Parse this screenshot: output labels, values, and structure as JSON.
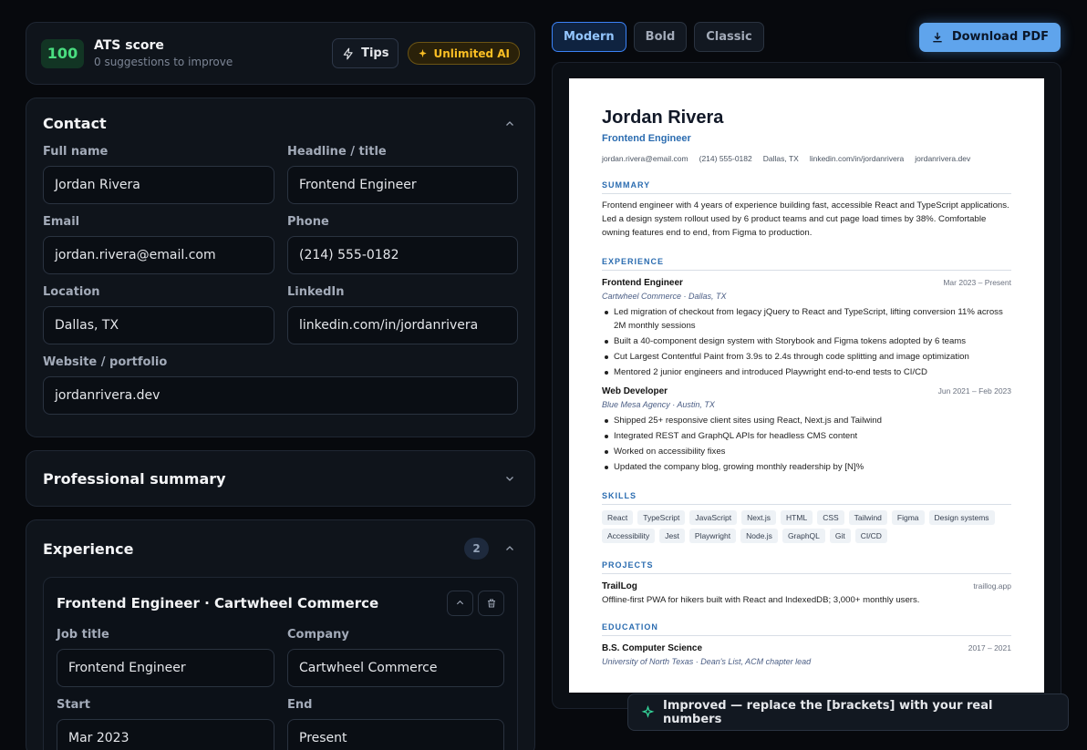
{
  "ats": {
    "score": "100",
    "title": "ATS score",
    "subtitle": "0 suggestions to improve",
    "tips_label": "Tips",
    "ai_badge": "Unlimited AI"
  },
  "contact": {
    "title": "Contact",
    "fields": [
      {
        "label": "Full name",
        "value": "Jordan Rivera"
      },
      {
        "label": "Headline / title",
        "value": "Frontend Engineer"
      },
      {
        "label": "Email",
        "value": "jordan.rivera@email.com"
      },
      {
        "label": "Phone",
        "value": "(214) 555-0182"
      },
      {
        "label": "Location",
        "value": "Dallas, TX"
      },
      {
        "label": "LinkedIn",
        "value": "linkedin.com/in/jordanrivera"
      },
      {
        "label": "Website / portfolio",
        "value": "jordanrivera.dev"
      }
    ]
  },
  "summary_section": {
    "title": "Professional summary"
  },
  "experience_section": {
    "title": "Experience",
    "count": "2",
    "job": {
      "title": "Frontend Engineer · Cartwheel Commerce",
      "fields": [
        {
          "label": "Job title",
          "value": "Frontend Engineer"
        },
        {
          "label": "Company",
          "value": "Cartwheel Commerce"
        },
        {
          "label": "Start",
          "value": "Mar 2023"
        },
        {
          "label": "End",
          "value": "Present"
        }
      ]
    }
  },
  "templates": [
    "Modern",
    "Bold",
    "Classic"
  ],
  "download_label": "Download PDF",
  "resume": {
    "name": "Jordan Rivera",
    "headline": "Frontend Engineer",
    "contact": [
      "jordan.rivera@email.com",
      "(214) 555-0182",
      "Dallas, TX",
      "linkedin.com/in/jordanrivera",
      "jordanrivera.dev"
    ],
    "summary_heading": "SUMMARY",
    "summary": "Frontend engineer with 4 years of experience building fast, accessible React and TypeScript applications. Led a design system rollout used by 6 product teams and cut page load times by 38%. Comfortable owning features end to end, from Figma to production.",
    "experience_heading": "EXPERIENCE",
    "jobs": [
      {
        "title": "Frontend Engineer",
        "dates": "Mar 2023 – Present",
        "company": "Cartwheel Commerce · Dallas, TX",
        "bullets": [
          "Led migration of checkout from legacy jQuery to React and TypeScript, lifting conversion 11% across 2M monthly sessions",
          "Built a 40-component design system with Storybook and Figma tokens adopted by 6 teams",
          "Cut Largest Contentful Paint from 3.9s to 2.4s through code splitting and image optimization",
          "Mentored 2 junior engineers and introduced Playwright end-to-end tests to CI/CD"
        ]
      },
      {
        "title": "Web Developer",
        "dates": "Jun 2021 – Feb 2023",
        "company": "Blue Mesa Agency · Austin, TX",
        "bullets": [
          "Shipped 25+ responsive client sites using React, Next.js and Tailwind",
          "Integrated REST and GraphQL APIs for headless CMS content",
          "Worked on accessibility fixes",
          "Updated the company blog, growing monthly readership by [N]%"
        ]
      }
    ],
    "skills_heading": "SKILLS",
    "skills": [
      "React",
      "TypeScript",
      "JavaScript",
      "Next.js",
      "HTML",
      "CSS",
      "Tailwind",
      "Figma",
      "Design systems",
      "Accessibility",
      "Jest",
      "Playwright",
      "Node.js",
      "GraphQL",
      "Git",
      "CI/CD"
    ],
    "projects_heading": "PROJECTS",
    "project": {
      "name": "TrailLog",
      "link": "traillog.app",
      "desc": "Offline-first PWA for hikers built with React and IndexedDB; 3,000+ monthly users."
    },
    "education_heading": "EDUCATION",
    "education": {
      "degree": "B.S. Computer Science",
      "dates": "2017 – 2021",
      "school": "University of North Texas · Dean's List, ACM chapter lead"
    }
  },
  "toast": "Improved — replace the [brackets] with your real numbers",
  "colors": {
    "accent": "#5fa4ec",
    "score_green": "#4ade80",
    "ai_gold": "#fbbf24",
    "resume_blue": "#2b6cb0"
  }
}
